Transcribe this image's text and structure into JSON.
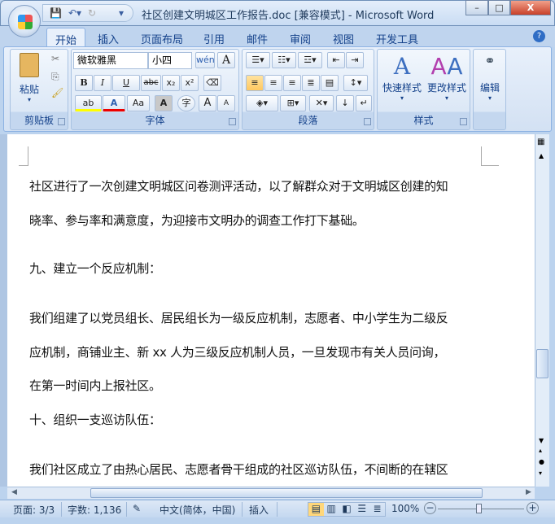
{
  "window": {
    "title": "社区创建文明城区工作报告.doc [兼容模式] - Microsoft Word",
    "minimize": "–",
    "maximize": "□",
    "close": "X"
  },
  "tabs": [
    "开始",
    "插入",
    "页面布局",
    "引用",
    "邮件",
    "审阅",
    "视图",
    "开发工具"
  ],
  "ribbon": {
    "clipboard": {
      "label": "剪贴板",
      "paste": "粘贴"
    },
    "font": {
      "label": "字体",
      "font_name": "微软雅黑",
      "font_size": "小四",
      "bold": "B",
      "italic": "I",
      "underline": "U",
      "strike": "abc",
      "sub": "x₂",
      "sup": "x²",
      "phonetic": "wén",
      "change_case": "Aa",
      "grow": "A",
      "shrink": "A",
      "char_border": "A",
      "enclose": "字",
      "color_a": "A",
      "highlight": "ab"
    },
    "paragraph": {
      "label": "段落"
    },
    "styles": {
      "label": "样式",
      "quick_styles": "快速样式",
      "change_styles": "更改样式"
    },
    "editing": {
      "label": "编辑"
    }
  },
  "document": {
    "lines": [
      "社区进行了一次创建文明城区问卷测评活动，以了解群众对于文明城区创建的知",
      "晓率、参与率和满意度，为迎接市文明办的调查工作打下基础。",
      "九、建立一个反应机制：",
      "我们组建了以党员组长、居民组长为一级反应机制，志愿者、中小学生为二级反",
      "应机制，商铺业主、新 xx 人为三级反应机制人员，一旦发现市有关人员问询，",
      "在第一时间内上报社区。",
      "十、组织一支巡访队伍：",
      "我们社区成立了由热心居民、志愿者骨干组成的社区巡访队伍，不间断的在辖区"
    ]
  },
  "status": {
    "page": "页面: 3/3",
    "words": "字数: 1,136",
    "language": "中文(简体，中国)",
    "mode": "插入",
    "zoom": "100%"
  },
  "colors": {
    "accent": "#15428b",
    "ribbon_bg": "#dbe7f6"
  }
}
